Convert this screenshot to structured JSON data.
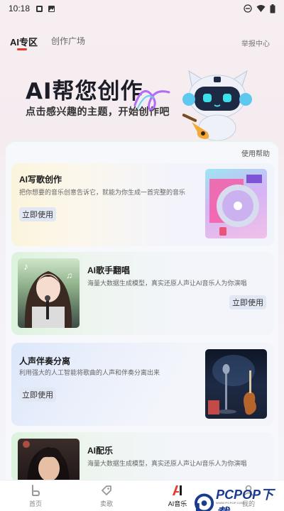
{
  "status_bar": {
    "time": "10:18"
  },
  "top_tabs": [
    {
      "label": "AI专区",
      "active": true
    },
    {
      "label": "创作广场",
      "active": false
    }
  ],
  "report_label": "举报中心",
  "hero": {
    "title": "AI帮您创作",
    "subtitle": "点击感兴趣的主题，开始创作吧"
  },
  "help_label": "使用帮助",
  "cards": [
    {
      "title": "AI写歌创作",
      "desc": "把你想要的音乐创意告诉它，就能为你生成一首完整的音乐",
      "button": "立即使用"
    },
    {
      "title": "AI歌手翻唱",
      "desc": "海量大数据生成模型，真实还原人声让AI音乐人为你演唱",
      "button": "立即使用"
    },
    {
      "title": "人声伴奏分离",
      "desc": "利用强大的人工智能将歌曲的人声和伴奏分离出来",
      "button": "立即使用"
    },
    {
      "title": "AI配乐",
      "desc": "海量大数据生成模型，真实还原人声让AI音乐人为你演唱",
      "button": ""
    }
  ],
  "bottom_nav": [
    {
      "label": "首页",
      "icon": "home-icon",
      "active": false
    },
    {
      "label": "卖歌",
      "icon": "tag-icon",
      "active": false
    },
    {
      "label": "AI音乐",
      "icon": "ai-music-icon",
      "active": true
    },
    {
      "label": "我的",
      "icon": "profile-icon",
      "active": false
    }
  ],
  "watermark": {
    "brand": "PCPOP下载",
    "sub": "WWW.PCPOP.COM"
  },
  "colors": {
    "accent": "#e8382f",
    "button_bg": "#e2e7f4"
  }
}
